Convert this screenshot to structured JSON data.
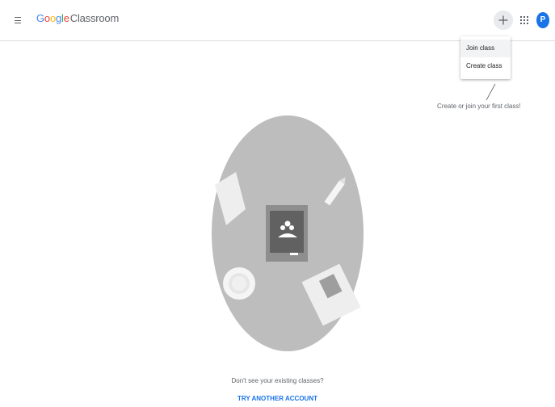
{
  "header": {
    "brand_g": "G",
    "brand_o1": "o",
    "brand_o2": "o",
    "brand_g2": "g",
    "brand_l": "l",
    "brand_e": "e",
    "product": "Classroom",
    "avatar_letter": "P"
  },
  "dropdown": {
    "items": [
      {
        "label": "Join class"
      },
      {
        "label": "Create class"
      }
    ]
  },
  "hint": {
    "text": "Create or join your first class!"
  },
  "empty_state": {
    "message": "Don't see your existing classes?",
    "action_label": "TRY ANOTHER ACCOUNT"
  },
  "colors": {
    "accent": "#1a73e8",
    "google_blue": "#4285f4",
    "google_red": "#ea4335",
    "google_yellow": "#fbbc05",
    "google_green": "#34a853"
  },
  "icons": {
    "menu": "menu-icon",
    "add": "plus-icon",
    "apps": "apps-grid-icon"
  }
}
